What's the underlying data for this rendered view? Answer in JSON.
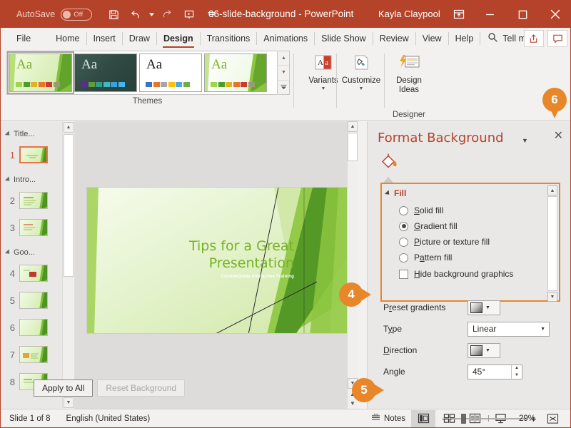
{
  "titlebar": {
    "autosave_label": "AutoSave",
    "autosave_state": "Off",
    "document_title": "06-slide-background  -  PowerPoint",
    "user_name": "Kayla Claypool",
    "save_icon": "save-icon",
    "undo_icon": "undo-icon",
    "redo_icon": "redo-icon",
    "present_icon": "start-slideshow-icon",
    "customize_qat_icon": "customize-quick-access-toolbar-icon",
    "ribbon_display_icon": "ribbon-display-options-icon",
    "minimize_icon": "minimize-icon",
    "maximize_icon": "maximize-icon",
    "close_icon": "close-icon",
    "accent_color": "#b5432a"
  },
  "tabs": [
    {
      "label": "File",
      "active": false
    },
    {
      "label": "Home",
      "active": false
    },
    {
      "label": "Insert",
      "active": false
    },
    {
      "label": "Draw",
      "active": false
    },
    {
      "label": "Design",
      "active": true
    },
    {
      "label": "Transitions",
      "active": false
    },
    {
      "label": "Animations",
      "active": false
    },
    {
      "label": "Slide Show",
      "active": false
    },
    {
      "label": "Review",
      "active": false
    },
    {
      "label": "View",
      "active": false
    },
    {
      "label": "Help",
      "active": false
    }
  ],
  "tellme": {
    "label": "Tell me",
    "search_icon": "search-icon",
    "share_icon": "share-icon",
    "comments_icon": "comments-icon"
  },
  "ribbon": {
    "themes_group_label": "Themes",
    "designer_group_label": "Designer",
    "themes": [
      {
        "name": "Facet green theme",
        "aa": "Aa",
        "selected": true,
        "aa_color": "#76b227",
        "bg": "linear-gradient(120deg,#f3fbe6 0%,#ddf0bd 55%,#cfe9a6 100%)",
        "swatches": [
          "#9fd44e",
          "#4a9e2a",
          "#ddb520",
          "#e8742a",
          "#cc3b2a",
          "#9a9a73"
        ]
      },
      {
        "name": "Ion Boardroom dark theme",
        "aa": "Aa",
        "selected": false,
        "aa_color": "#dfe6e2",
        "bg": "linear-gradient(135deg,#3e5b52 0%,#2e4740 60%,#27403a 100%)",
        "swatches": [
          "#5b2d91",
          "#5b9e3a",
          "#2f9e8c",
          "#3bb9c4",
          "#3ba1dd",
          "#3fb6ef"
        ]
      },
      {
        "name": "Office blank white theme",
        "aa": "Aa",
        "selected": false,
        "aa_color": "#1a1a1a",
        "bg": "#ffffff",
        "swatches": [
          "#3a72c4",
          "#e8742a",
          "#a6a6a6",
          "#ffc000",
          "#4da6e8",
          "#70ad47"
        ]
      },
      {
        "name": "Facet variant theme",
        "aa": "Aa",
        "selected": false,
        "aa_color": "#76b227",
        "bg": "linear-gradient(120deg,#ffffff 0%,#f2faea 60%,#e7f5d8 100%)",
        "swatches": [
          "#9fd44e",
          "#4a9e2a",
          "#ddb520",
          "#e8742a",
          "#cc3b2a",
          "#9a9a73"
        ]
      }
    ],
    "gallery_scroll_up_icon": "scroll-up-icon",
    "gallery_scroll_down_icon": "scroll-down-icon",
    "gallery_more_icon": "gallery-more-icon",
    "buttons": [
      {
        "label": "Variants",
        "icon": "variants-icon",
        "has_caret": true
      },
      {
        "label": "Customize",
        "icon": "customize-icon",
        "has_caret": true
      },
      {
        "label": "Design\nIdeas",
        "label_line1": "Design",
        "label_line2": "Ideas",
        "icon": "design-ideas-icon",
        "has_caret": false
      }
    ]
  },
  "thumbnails": {
    "sections": [
      {
        "name": "Title...",
        "collapse_icon": "collapse-section-icon"
      },
      {
        "name": "Intro...",
        "collapse_icon": "collapse-section-icon"
      },
      {
        "name": "Goo...",
        "collapse_icon": "collapse-section-icon"
      }
    ],
    "slides": [
      {
        "number": "1",
        "active": true
      },
      {
        "number": "2",
        "active": false
      },
      {
        "number": "3",
        "active": false
      },
      {
        "number": "4",
        "active": false
      },
      {
        "number": "5",
        "active": false
      },
      {
        "number": "6",
        "active": false
      },
      {
        "number": "7",
        "active": false
      },
      {
        "number": "8",
        "active": false
      }
    ],
    "scroll_up_icon": "scroll-up-icon",
    "scroll_down_icon": "scroll-down-icon"
  },
  "slide": {
    "title": "Tips for a Great Presentation",
    "subtitle": "CustomGuide Interactive Training",
    "title_color": "#76b227",
    "scroll_up_icon": "scroll-up-icon",
    "scroll_down_icon": "scroll-down-icon",
    "previous_slide_icon": "previous-slide-icon",
    "next_slide_icon": "next-slide-icon"
  },
  "format_background": {
    "title": "Format Background",
    "menu_caret_icon": "chevron-down-icon",
    "close_icon": "close-icon",
    "fill_tab_icon": "fill-bucket-icon",
    "section_label": "Fill",
    "section_collapse_icon": "collapse-icon",
    "fill_options": [
      {
        "label": "Solid fill",
        "accel": "S",
        "selected": false
      },
      {
        "label": "Gradient fill",
        "accel": "G",
        "selected": true
      },
      {
        "label": "Picture or texture fill",
        "accel": "P",
        "selected": false
      },
      {
        "label": "Pattern fill",
        "accel": "a",
        "selected": false
      }
    ],
    "hide_background_graphics": {
      "label": "Hide background graphics",
      "checked": false
    },
    "settings": [
      {
        "label": "Preset gradients",
        "control": "swatch",
        "value": ""
      },
      {
        "label": "Type",
        "control": "combo",
        "value": "Linear"
      },
      {
        "label": "Direction",
        "control": "swatch",
        "value": ""
      },
      {
        "label": "Angle",
        "control": "spinner",
        "value": "45°"
      }
    ],
    "apply_to_all_label": "Apply to All",
    "reset_background_label": "Reset Background",
    "reset_background_disabled": true,
    "scroll_up_icon": "scroll-up-icon",
    "scroll_down_icon": "scroll-down-icon",
    "highlight_color": "#e8862a"
  },
  "callouts": [
    {
      "number": "4",
      "direction": "right"
    },
    {
      "number": "5",
      "direction": "right"
    },
    {
      "number": "6",
      "direction": "down"
    }
  ],
  "statusbar": {
    "slide_count": "Slide 1 of 8",
    "language": "English (United States)",
    "notes_label": "Notes",
    "notes_icon": "notes-icon",
    "views": [
      {
        "name": "normal-view",
        "icon": "normal-view-icon",
        "active": true
      },
      {
        "name": "slide-sorter-view",
        "icon": "slide-sorter-icon",
        "active": false
      },
      {
        "name": "reading-view",
        "icon": "reading-view-icon",
        "active": false
      },
      {
        "name": "slide-show-view",
        "icon": "slide-show-icon",
        "active": false
      }
    ],
    "zoom_out_label": "−",
    "zoom_in_label": "+",
    "zoom_level": "29%",
    "fit_slide_icon": "fit-slide-to-window-icon"
  }
}
